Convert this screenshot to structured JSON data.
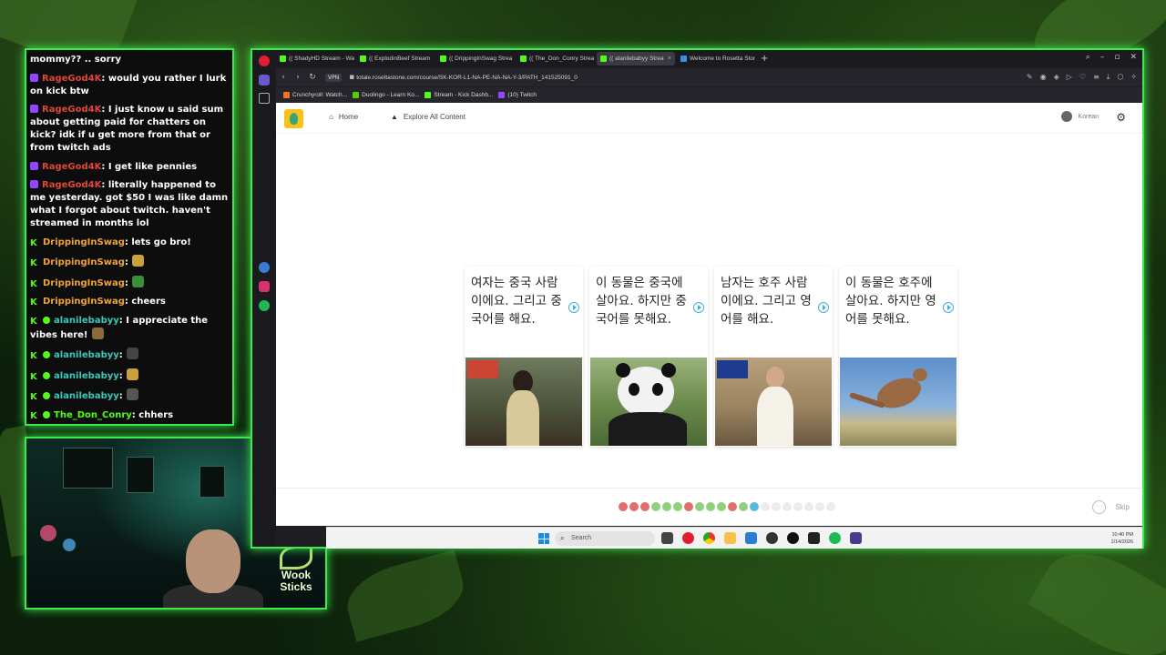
{
  "chat": {
    "messages": [
      {
        "platform": "none",
        "user": "",
        "text": "mommy?? .. sorry",
        "user_color": "#ffffff"
      },
      {
        "platform": "twitch",
        "user": "RageGod4K",
        "text": ": would you rather I lurk on kick btw",
        "user_color": "#e0463a"
      },
      {
        "platform": "twitch",
        "user": "RageGod4K",
        "text": ": I just know u said sum about getting paid for chatters on kick? idk if u get more from that or from twitch ads",
        "user_color": "#e0463a"
      },
      {
        "platform": "twitch",
        "user": "RageGod4K",
        "text": ": I get like pennies",
        "user_color": "#e0463a"
      },
      {
        "platform": "twitch",
        "user": "RageGod4K",
        "text": ": literally happened to me yesterday. got $50 I was like damn what I forgot about twitch. haven't streamed in months lol",
        "user_color": "#e0463a"
      },
      {
        "platform": "kick",
        "user": "DrippingInSwag",
        "text": ": lets go bro!",
        "user_color": "#f0a53a"
      },
      {
        "platform": "kick",
        "user": "DrippingInSwag",
        "text": ":",
        "user_color": "#f0a53a",
        "emote": true
      },
      {
        "platform": "kick",
        "user": "DrippingInSwag",
        "text": ":",
        "user_color": "#f0a53a",
        "emote": true
      },
      {
        "platform": "kick",
        "user": "DrippingInSwag",
        "text": ": cheers",
        "user_color": "#f0a53a"
      },
      {
        "platform": "kick-verified",
        "user": "alanilebabyy",
        "text": ": I appreciate the vibes here!",
        "user_color": "#39c9b8",
        "emote": true
      },
      {
        "platform": "kick-verified",
        "user": "alanilebabyy",
        "text": ":",
        "user_color": "#39c9b8",
        "emote": true
      },
      {
        "platform": "kick-verified",
        "user": "alanilebabyy",
        "text": ":",
        "user_color": "#39c9b8",
        "emote": true
      },
      {
        "platform": "kick-verified",
        "user": "alanilebabyy",
        "text": ":",
        "user_color": "#39c9b8",
        "emote": true
      },
      {
        "platform": "kick-verified",
        "user": "The_Don_Conry",
        "text": ": chhers",
        "user_color": "#53fc18"
      }
    ]
  },
  "webcam": {
    "logo_line1": "Wook",
    "logo_line2": "Sticks"
  },
  "browser": {
    "tabs": [
      {
        "label": "(( ShadyHD Stream - Wa",
        "active": false,
        "fav_color": "#53fc18"
      },
      {
        "label": "(( ExplodinBeef Stream",
        "active": false,
        "fav_color": "#53fc18"
      },
      {
        "label": "(( DrippingInSwag Strea",
        "active": false,
        "fav_color": "#53fc18"
      },
      {
        "label": "(( The_Don_Conry Strea",
        "active": false,
        "fav_color": "#53fc18"
      },
      {
        "label": "(( alanilebabyy Strea",
        "active": true,
        "fav_color": "#53fc18"
      },
      {
        "label": "Welcome to Rosetta Stone",
        "active": false,
        "fav_color": "#3a8fe0"
      }
    ],
    "new_tab": "+",
    "vpn_label": "VPN",
    "url": "totale.rosettastone.com/course/SK-KOR-L1-NA-PE-NA-NA-Y-3/PATH_141525091_0",
    "bookmarks": [
      {
        "label": "Crunchyroll: Watch...",
        "fav_color": "#f47521"
      },
      {
        "label": "Duolingo - Learn Ko...",
        "fav_color": "#58cc02"
      },
      {
        "label": "Stream - Kick Dashb...",
        "fav_color": "#53fc18"
      },
      {
        "label": "(10) Twitch",
        "fav_color": "#9146ff"
      }
    ]
  },
  "app": {
    "nav": {
      "home": "Home",
      "explore": "Explore All Content"
    },
    "profile_language": "Korean",
    "cards": [
      {
        "text": "여자는 중국 사람이에요. 그리고 중국어를 해요.",
        "image": "woman-icon"
      },
      {
        "text": "이 동물은 중국에 살아요. 하지만 중국어를 못해요.",
        "image": "panda-icon"
      },
      {
        "text": "남자는 호주 사람이에요. 그리고 영어를 해요.",
        "image": "man-icon"
      },
      {
        "text": "이 동물은 호주에 살아요. 하지만 영어를 못해요.",
        "image": "kangaroo-icon"
      }
    ],
    "progress": [
      "wrong",
      "wrong",
      "wrong",
      "right",
      "right",
      "right",
      "wrong",
      "right",
      "right",
      "right",
      "wrong",
      "right",
      "current",
      "todo",
      "todo",
      "todo",
      "todo",
      "todo",
      "todo",
      "todo"
    ],
    "skip_label": "Skip"
  },
  "taskbar": {
    "search_placeholder": "Search",
    "time": "10:40 PM",
    "date": "1/14/2026"
  }
}
